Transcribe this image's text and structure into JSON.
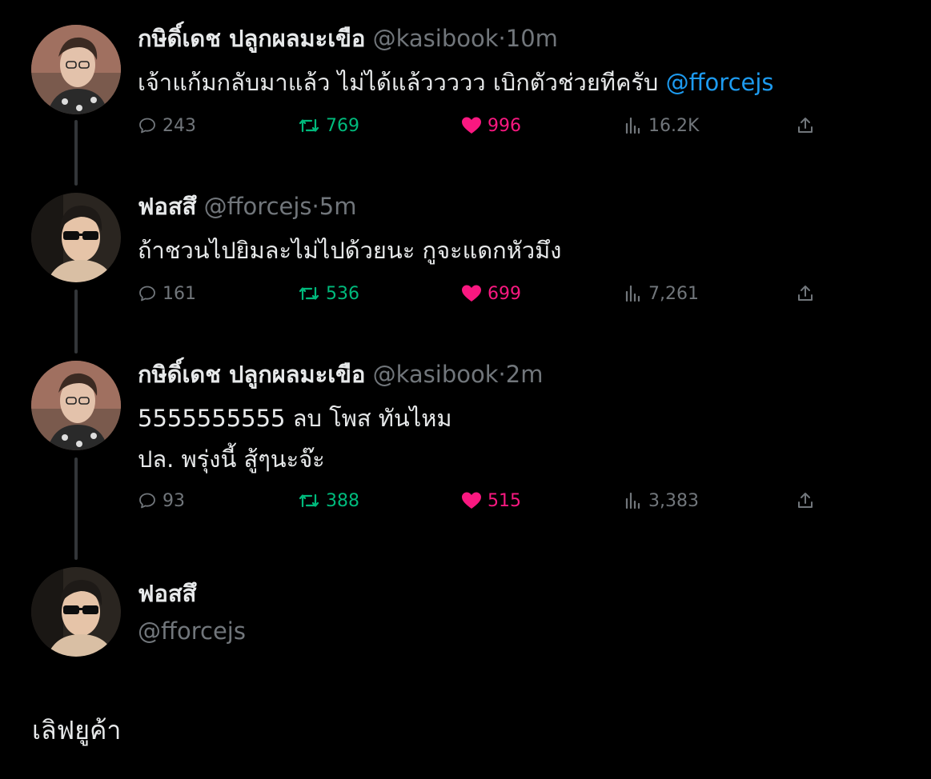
{
  "tweets": [
    {
      "display_name": "กษิดิ์เดช ปลูกผลมะเขือ",
      "handle": "@kasibook",
      "separator": "·",
      "time": "10m",
      "text_line1": "เจ้าแก้มกลับมาแล้ว ไม่ได้แล้ววววว เบิกตัวช่วยทีครับ",
      "mention": "@fforcejs",
      "replies": "243",
      "retweets": "769",
      "likes": "996",
      "views": "16.2K"
    },
    {
      "display_name": "ฟอสสึ",
      "handle": "@fforcejs",
      "separator": "·",
      "time": "5m",
      "text_line1": "ถ้าชวนไปยิมละไม่ไปด้วยนะ กูจะแดกหัวมึง",
      "replies": "161",
      "retweets": "536",
      "likes": "699",
      "views": "7,261"
    },
    {
      "display_name": "กษิดิ์เดช ปลูกผลมะเขือ",
      "handle": "@kasibook",
      "separator": "·",
      "time": "2m",
      "text_line1": "5555555555 ลบ โพส ทันไหม",
      "text_line2": "ปล. พรุ่งนี้ สู้ๆนะจ๊ะ",
      "replies": "93",
      "retweets": "388",
      "likes": "515",
      "views": "3,383"
    }
  ],
  "profile": {
    "display_name": "ฟอสสึ",
    "handle": "@fforcejs",
    "bio": "เลิฟยูค้า"
  },
  "icons": {
    "reply": "reply-icon",
    "retweet": "retweet-icon",
    "like": "heart-icon",
    "views": "views-icon",
    "share": "share-icon"
  },
  "colors": {
    "background": "#000000",
    "text": "#e7e9ea",
    "muted": "#71767b",
    "mention": "#1d9bf0",
    "retweet": "#00ba7c",
    "like": "#f91880",
    "thread_line": "#333639"
  }
}
